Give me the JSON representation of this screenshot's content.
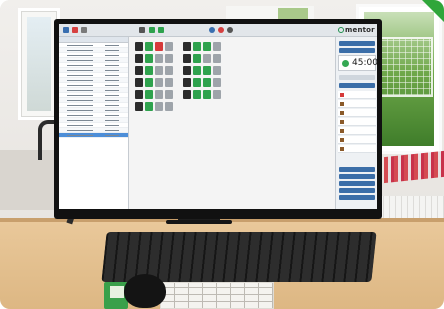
{
  "scene": {
    "description_kind": "photo",
    "screen_app": {
      "brand": "mentor",
      "timer": "45:00",
      "status_colors": {
        "accent": "#1e8f4d",
        "online": "#2ea24d",
        "offline": "#2c2c2c",
        "alert": "#d63a3a",
        "selection": "#4d8ed8"
      }
    }
  }
}
